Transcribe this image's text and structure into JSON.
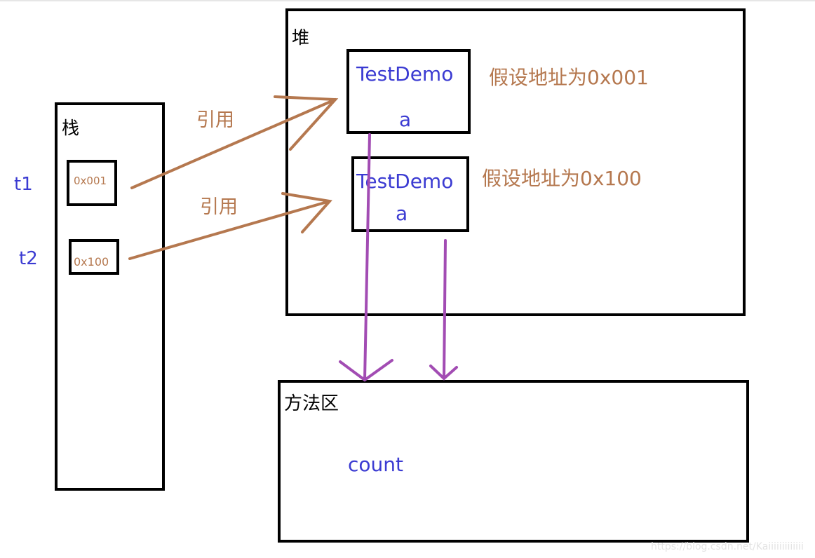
{
  "colors": {
    "reference": "#b5784f",
    "label": "#3b3bd2",
    "pointer": "#a24cb3"
  },
  "stack": {
    "title": "栈",
    "vars": [
      {
        "name": "t1",
        "value": "0x001"
      },
      {
        "name": "t2",
        "value": "0x100"
      }
    ]
  },
  "arrows": {
    "ref1": "引用",
    "ref2": "引用"
  },
  "heap": {
    "title": "堆",
    "objects": [
      {
        "class": "TestDemo",
        "field": "a",
        "note": "假设地址为0x001"
      },
      {
        "class": "TestDemo",
        "field": "a",
        "note": "假设地址为0x100"
      }
    ]
  },
  "method_area": {
    "title": "方法区",
    "field": "count"
  },
  "watermark": "https://blog.csdn.net/Kaiiiiiiiiiiiii"
}
